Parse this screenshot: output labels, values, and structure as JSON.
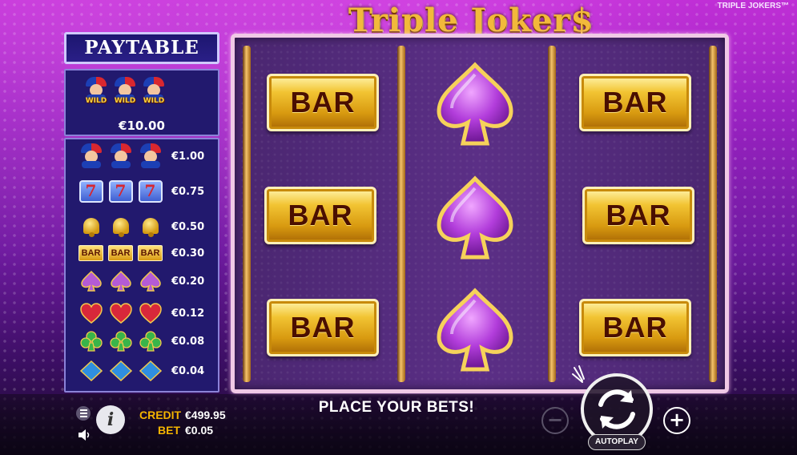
{
  "header": {
    "title": "Triple Joker$",
    "brand_tag": "TRIPLE JOKERS™"
  },
  "paytable": {
    "title": "PAYTABLE",
    "wild_label": "WILD",
    "wild_prize": "€10.00",
    "rows": [
      {
        "symbol": "joker-icon",
        "prize": "€1.00"
      },
      {
        "symbol": "seven-icon",
        "prize": "€0.75"
      },
      {
        "symbol": "bell-icon",
        "prize": "€0.50"
      },
      {
        "symbol": "bar-icon",
        "prize": "€0.30",
        "label": "BAR"
      },
      {
        "symbol": "spade-icon",
        "prize": "€0.20"
      },
      {
        "symbol": "heart-icon",
        "prize": "€0.12"
      },
      {
        "symbol": "club-icon",
        "prize": "€0.08"
      },
      {
        "symbol": "diamond-icon",
        "prize": "€0.04"
      }
    ],
    "seven_glyph": "7"
  },
  "reels": {
    "columns": [
      [
        "BAR",
        "BAR",
        "BAR"
      ],
      [
        "spade",
        "spade",
        "spade"
      ],
      [
        "BAR",
        "BAR",
        "BAR"
      ]
    ],
    "bar_text": "BAR"
  },
  "controls": {
    "credit_label": "CREDIT",
    "credit_value": "€499.95",
    "bet_label": "BET",
    "bet_value": "€0.05",
    "status_message": "PLACE YOUR BETS!",
    "autoplay_label": "AUTOPLAY",
    "minus_label": "−",
    "plus_label": "+",
    "info_label": "i"
  },
  "colors": {
    "accent_gold": "#f4b400",
    "panel_blue": "#22196e",
    "background_purple": "#9a22c2"
  }
}
